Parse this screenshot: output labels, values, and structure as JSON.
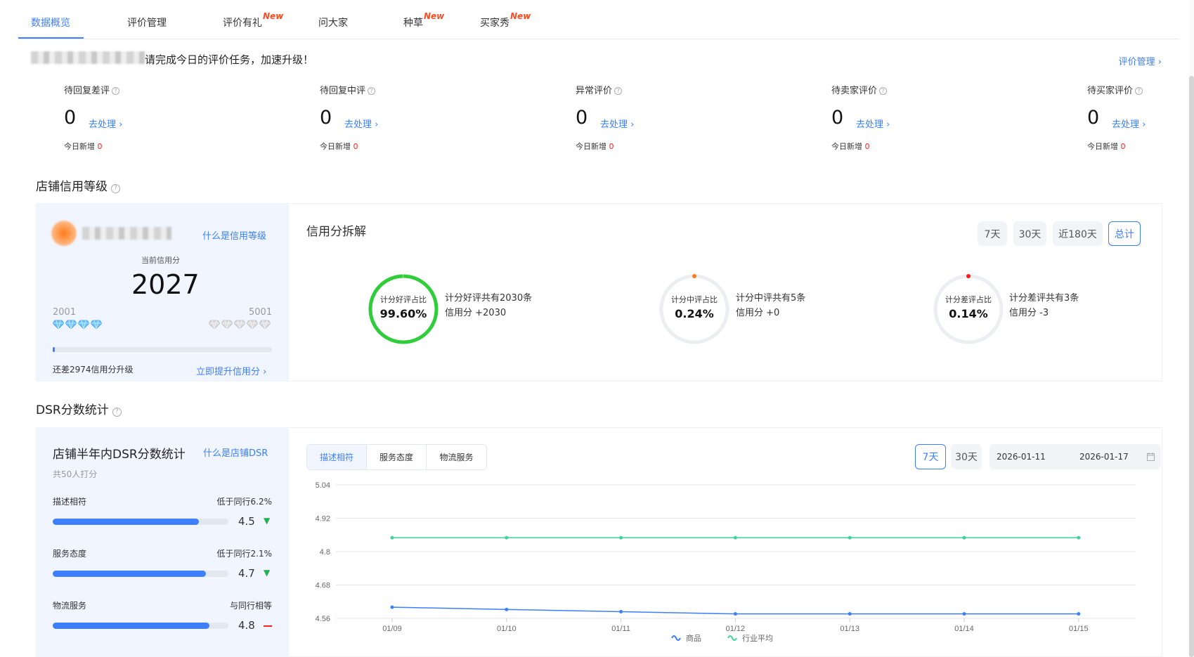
{
  "tabs": [
    {
      "label": "数据概览",
      "new": ""
    },
    {
      "label": "评价管理",
      "new": ""
    },
    {
      "label": "评价有礼",
      "new": "New"
    },
    {
      "label": "问大家",
      "new": ""
    },
    {
      "label": "种草",
      "new": "New"
    },
    {
      "label": "买家秀",
      "new": "New"
    }
  ],
  "notice": {
    "text": "请完成今日的评价任务，加速升级！",
    "link": "评价管理 ›"
  },
  "pending": [
    {
      "label": "待回复差评",
      "count": "0",
      "action": "去处理 ›",
      "today_label": "今日新增",
      "today_value": "0"
    },
    {
      "label": "待回复中评",
      "count": "0",
      "action": "去处理 ›",
      "today_label": "今日新增",
      "today_value": "0"
    },
    {
      "label": "异常评价",
      "count": "0",
      "action": "去处理 ›",
      "today_label": "今日新增",
      "today_value": "0"
    },
    {
      "label": "待卖家评价",
      "count": "0",
      "action": "去处理 ›",
      "today_label": "今日新增",
      "today_value": "0"
    },
    {
      "label": "待买家评价",
      "count": "0",
      "action": "去处理 ›",
      "today_label": "今日新增",
      "today_value": "0"
    }
  ],
  "credit": {
    "section_title": "店铺信用等级",
    "what_link": "什么是信用等级",
    "current_label": "当前信用分",
    "score": "2027",
    "level_min": "2001",
    "level_max": "5001",
    "progress": 0.009,
    "upgrade_text": "还差2974信用分升级",
    "upgrade_link": "立即提升信用分 ›",
    "breakdown_title": "信用分拆解",
    "ranges": [
      "7天",
      "30天",
      "近180天",
      "总计"
    ],
    "active_range": "总计",
    "rings": [
      {
        "title": "计分好评占比",
        "value": "99.60%",
        "fraction": 0.996,
        "color": "#2fcd3a",
        "line1": "计分好评共有2030条",
        "line2": "信用分 +2030"
      },
      {
        "title": "计分中评占比",
        "value": "0.24%",
        "fraction": 0.0024,
        "color": "#ff7a1a",
        "line1": "计分中评共有5条",
        "line2": "信用分 +0"
      },
      {
        "title": "计分差评占比",
        "value": "0.14%",
        "fraction": 0.0014,
        "color": "#ff1a1a",
        "line1": "计分差评共有3条",
        "line2": "信用分 -3"
      }
    ]
  },
  "dsr": {
    "section_title": "DSR分数统计",
    "title": "店铺半年内DSR分数统计",
    "what_link": "什么是店铺DSR",
    "count": "共50人打分",
    "items": [
      {
        "name": "描述相符",
        "compare": "低于同行6.2%",
        "score": "4.5",
        "fraction": 0.83,
        "trend": "down"
      },
      {
        "name": "服务态度",
        "compare": "低于同行2.1%",
        "score": "4.7",
        "fraction": 0.87,
        "trend": "down"
      },
      {
        "name": "物流服务",
        "compare": "与同行相等",
        "score": "4.8",
        "fraction": 0.89,
        "trend": "equal"
      }
    ],
    "segments": [
      "描述相符",
      "服务态度",
      "物流服务"
    ],
    "active_segment": "描述相符",
    "day_buttons": [
      "7天",
      "30天"
    ],
    "active_day": "7天",
    "date_start": "2026-01-11",
    "date_end": "2026-01-17"
  },
  "chart_data": {
    "type": "line",
    "x": [
      "01/09",
      "01/10",
      "01/11",
      "01/12",
      "01/13",
      "01/14",
      "01/15"
    ],
    "ylim": [
      4.56,
      5.04
    ],
    "yticks": [
      "5.04",
      "4.92",
      "4.8",
      "4.68",
      "4.56"
    ],
    "grid": true,
    "legend_position": "bottom",
    "series": [
      {
        "name": "商品",
        "color": "#3d7fff",
        "values": [
          4.6,
          4.592,
          4.584,
          4.576,
          4.576,
          4.576,
          4.576
        ]
      },
      {
        "name": "行业平均",
        "color": "#3fd399",
        "values": [
          4.85,
          4.85,
          4.85,
          4.85,
          4.85,
          4.85,
          4.85
        ]
      }
    ]
  }
}
